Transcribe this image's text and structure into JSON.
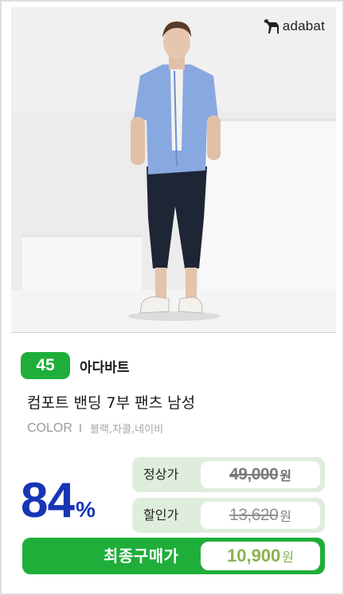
{
  "photo": {
    "logo_text": "adabat",
    "logo_icon": "dog-icon",
    "alt": "product-photo"
  },
  "info": {
    "badge": "45",
    "brand": "아다바트",
    "title": "컴포트 밴딩 7부 팬츠 남성",
    "color_label": "COLOR",
    "color_separator": "I",
    "color_values": "블랙,차콜,네이비"
  },
  "pricing": {
    "discount": "84",
    "discount_unit": "%",
    "regular_label": "정상가",
    "regular_price": "49,000",
    "regular_unit": "원",
    "sale_label": "할인가",
    "sale_price": "13,620",
    "sale_unit": "원",
    "final_label": "최종구매가",
    "final_price": "10,900",
    "final_unit": "원"
  },
  "colors": {
    "green": "#1fae3a",
    "light_green": "#dfeedc",
    "discount_blue": "#1735b6",
    "final_price_green": "#8bb34c"
  }
}
